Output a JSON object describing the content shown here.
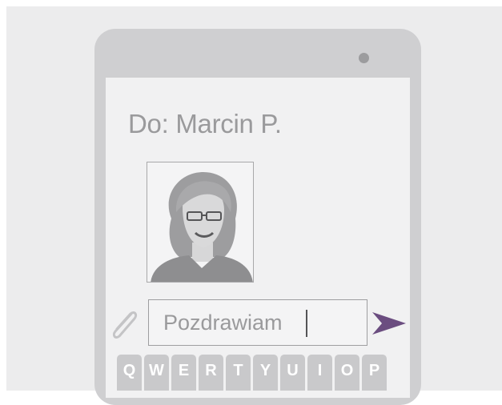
{
  "conversation": {
    "recipient_label": "Do: Marcin P."
  },
  "composer": {
    "message_text": "Pozdrawiam",
    "attach_icon": "paperclip-icon",
    "send_icon": "send-arrow-icon"
  },
  "keyboard": {
    "keys": [
      "Q",
      "W",
      "E",
      "R",
      "T",
      "Y",
      "U",
      "I",
      "O",
      "P"
    ]
  },
  "colors": {
    "accent": "#6b4d80",
    "screen_bg": "#f1f1f2",
    "phone_body": "#cfcfd1",
    "text_gray": "#9a9a9c"
  }
}
